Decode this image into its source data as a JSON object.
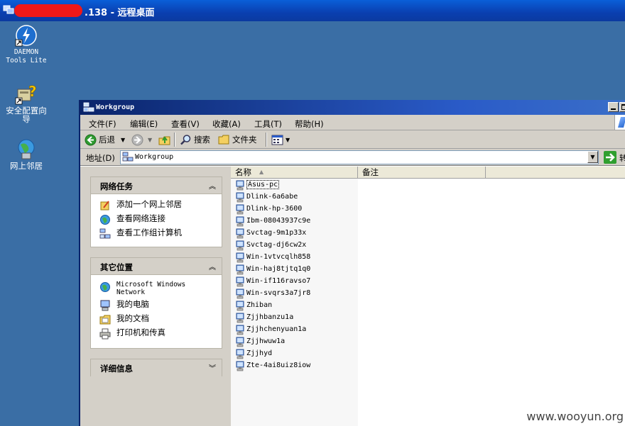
{
  "remote_desktop": {
    "title_suffix": ".138 - 远程桌面"
  },
  "desktop": {
    "icons": [
      {
        "label_line1": "DAEMON",
        "label_line2": "Tools Lite",
        "icon": "daemon-tools-icon"
      },
      {
        "label_line1": "安全配置向",
        "label_line2": "导",
        "icon": "security-wizard-icon"
      },
      {
        "label_line1": "网上邻居",
        "label_line2": "",
        "icon": "network-neighborhood-icon"
      }
    ]
  },
  "window": {
    "title": "Workgroup",
    "menu": [
      "文件(F)",
      "编辑(E)",
      "查看(V)",
      "收藏(A)",
      "工具(T)",
      "帮助(H)"
    ],
    "toolbar": {
      "back": "后退",
      "search": "搜索",
      "folders": "文件夹"
    },
    "address": {
      "label": "地址(D)",
      "value": "Workgroup",
      "go": "转"
    }
  },
  "tasks": {
    "network_tasks": {
      "title": "网络任务",
      "items": [
        "添加一个网上邻居",
        "查看网络连接",
        "查看工作组计算机"
      ]
    },
    "other_places": {
      "title": "其它位置",
      "items": [
        "Microsoft Windows Network",
        "我的电脑",
        "我的文档",
        "打印机和传真"
      ]
    },
    "details": {
      "title": "详细信息"
    }
  },
  "list": {
    "columns": [
      "名称",
      "备注"
    ],
    "items": [
      "Asus-pc",
      "Dlink-6a6abe",
      "Dlink-hp-3600",
      "Ibm-08043937c9e",
      "Svctag-9m1p33x",
      "Svctag-dj6cw2x",
      "Win-1vtvcqlh858",
      "Win-haj8tjtq1q0",
      "Win-if116ravso7",
      "Win-svqrs3a7jr8",
      "Zhiban",
      "Zjjhbanzu1a",
      "Zjjhchenyuan1a",
      "Zjjhwuw1a",
      "Zjjhyd",
      "Zte-4ai8uiz8iow"
    ]
  },
  "watermark": "www.wooyun.org",
  "colors": {
    "desktop": "#3a6ea5",
    "titlebar": "#0a246a",
    "redaction": "#f01818"
  }
}
